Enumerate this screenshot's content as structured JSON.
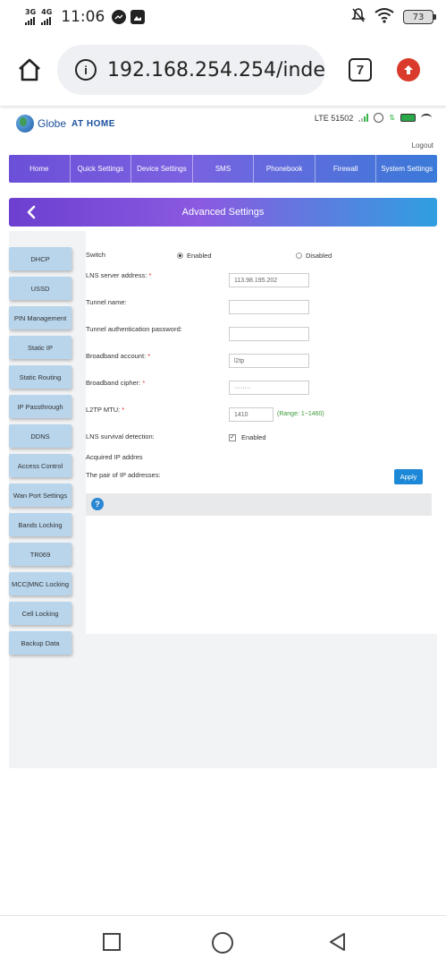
{
  "status_bar": {
    "net1": "3G",
    "net2": "4G",
    "time": "11:06",
    "battery": "73"
  },
  "browser": {
    "url": "192.168.254.254/inde",
    "tab_count": "7"
  },
  "header": {
    "brand": "Globe",
    "brand_sub": "AT HOME",
    "network": "LTE  51502",
    "logout": "Logout"
  },
  "nav": {
    "items": [
      "Home",
      "Quick Settings",
      "Device Settings",
      "SMS",
      "Phonebook",
      "Firewall",
      "System Settings"
    ]
  },
  "title": "Advanced Settings",
  "sidebar": {
    "items": [
      "DHCP",
      "USSD",
      "PIN Management",
      "Static IP",
      "Static Routing",
      "IP Passthrough",
      "DDNS",
      "Access Control",
      "Wan Port Settings",
      "Bands Locking",
      "TR069",
      "MCC|MNC Locking",
      "Cell Locking",
      "Backup Data"
    ]
  },
  "form": {
    "switch_label": "Switch",
    "enabled": "Enabled",
    "disabled": "Disabled",
    "lns_label": "LNS server address:",
    "lns_value": "113.98.195.202",
    "tunnel_name_label": "Tunnel name:",
    "tunnel_pw_label": "Tunnel authentication password:",
    "bb_account_label": "Broadband account:",
    "bb_account_value": "l2tp",
    "bb_cipher_label": "Broadband cipher:",
    "bb_cipher_value": "········",
    "mtu_label": "L2TP MTU:",
    "mtu_value": "1410",
    "mtu_range": "(Range: 1~1460)",
    "survival_label": "LNS survival detection:",
    "survival_enabled": "Enabled",
    "acquired_label": "Acquired IP addres",
    "pair_label": "The pair of IP addresses:",
    "required_mark": "*",
    "apply": "Apply",
    "help": "?"
  }
}
